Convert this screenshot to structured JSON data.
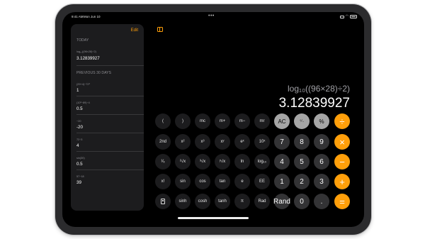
{
  "status": {
    "time": "9:41 AM",
    "date": "Mon Jun 10"
  },
  "sidebar": {
    "edit": "Edit",
    "today_header": "TODAY",
    "today": [
      {
        "expr": "log₁₀((96×28)÷2)",
        "result": "3.12839927"
      }
    ],
    "previous_header": "PREVIOUS 30 DAYS",
    "previous": [
      {
        "expr": "(29+4)−72³",
        "result": "1"
      },
      {
        "expr": "(10²−89)−4",
        "result": "0.5"
      },
      {
        "expr": "−20",
        "result": "-20"
      },
      {
        "expr": "72÷3",
        "result": "4"
      },
      {
        "expr": "sin(30)",
        "result": "0.5"
      },
      {
        "expr": "57−18",
        "result": "39"
      }
    ]
  },
  "display": {
    "expression": "log₁₀((96×28)÷2)",
    "value": "3.12839927"
  },
  "keypad": {
    "rows": [
      [
        "(",
        ")",
        "mc",
        "m+",
        "m−",
        "mr",
        "AC",
        "⁺∕₋",
        "%",
        "÷"
      ],
      [
        "2nd",
        "x²",
        "x³",
        "xʸ",
        "eˣ",
        "10ˣ",
        "7",
        "8",
        "9",
        "×"
      ],
      [
        "¹⁄ₓ",
        "²√x",
        "³√x",
        "ʸ√x",
        "ln",
        "log₁₀",
        "4",
        "5",
        "6",
        "−"
      ],
      [
        "x!",
        "sin",
        "cos",
        "tan",
        "e",
        "EE",
        "1",
        "2",
        "3",
        "+"
      ],
      [
        "calc-icon",
        "sinh",
        "cosh",
        "tanh",
        "π",
        "Rad",
        "Rand",
        "0",
        ".",
        "="
      ]
    ]
  },
  "colors": {
    "accent": "#ff9f0a",
    "function_key": "#a5a5a5",
    "digit_key": "#333335",
    "scientific_key": "#1c1c1e"
  }
}
